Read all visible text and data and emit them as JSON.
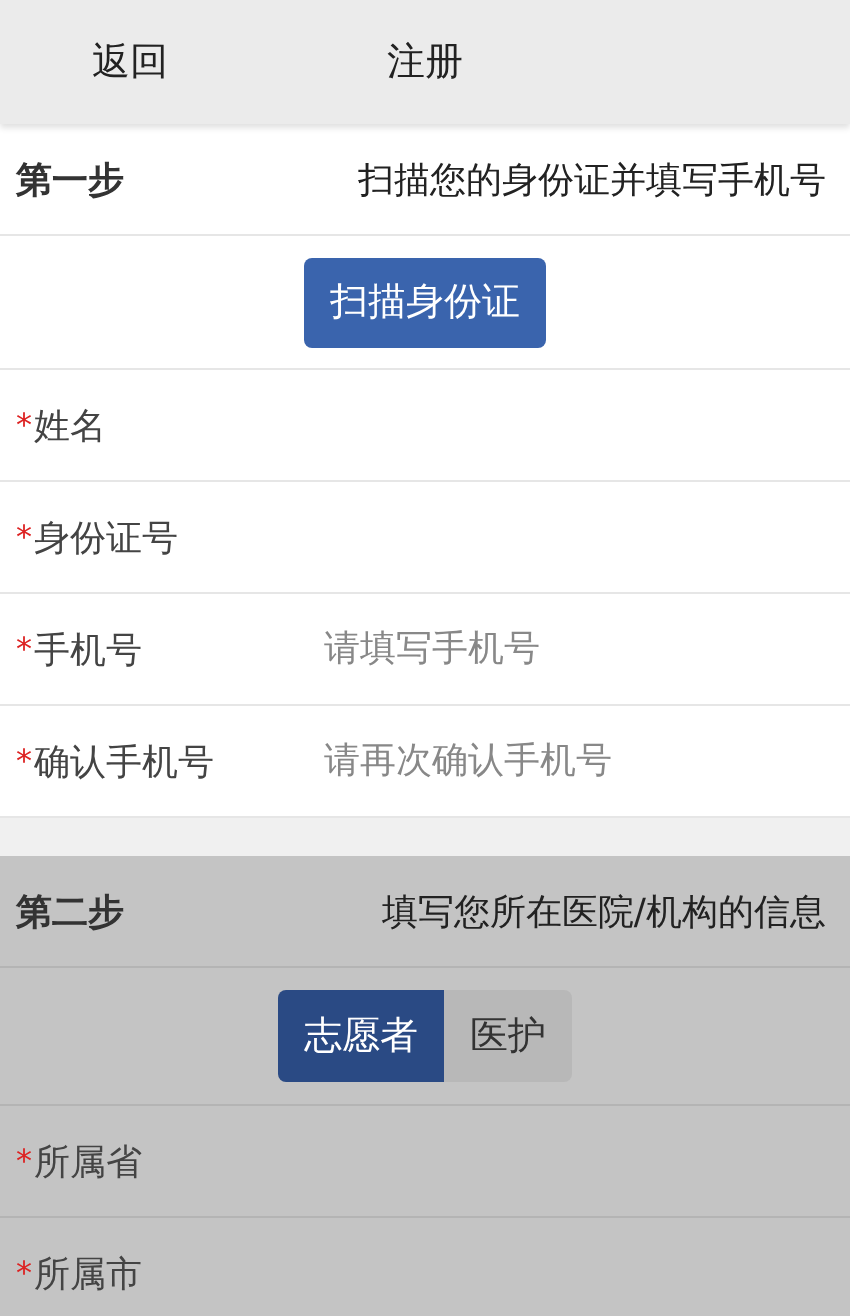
{
  "header": {
    "back": "返回",
    "title": "注册"
  },
  "sections": [
    {
      "step": "第一步",
      "description": "扫描您的身份证并填写手机号",
      "dimmed": false,
      "action": {
        "kind": "button",
        "label": "扫描身份证"
      },
      "fields": [
        {
          "mark": "*",
          "label": "姓名"
        },
        {
          "mark": "*",
          "label": "身份证号"
        },
        {
          "mark": "*",
          "label": "手机号",
          "placeholder": "请填写手机号"
        },
        {
          "mark": "*",
          "label": "确认手机号",
          "placeholder": "请再次确认手机号"
        }
      ]
    },
    {
      "step": "第二步",
      "description": "填写您所在医院/机构的信息",
      "dimmed": true,
      "action": {
        "kind": "segments",
        "options": [
          {
            "label": "志愿者",
            "selected": true
          },
          {
            "label": "医护",
            "selected": false
          }
        ]
      },
      "fields": [
        {
          "mark": "*",
          "label": "所属省"
        },
        {
          "mark": "*",
          "label": "所属市"
        }
      ]
    }
  ]
}
